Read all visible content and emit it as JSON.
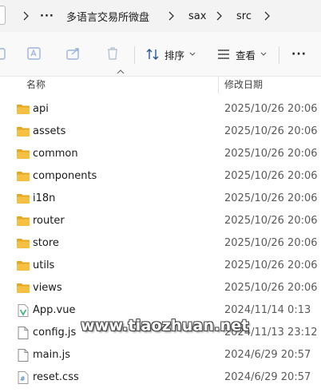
{
  "breadcrumb": {
    "more_label": "···",
    "items": [
      "多语言交易所微盘",
      "sax",
      "src"
    ]
  },
  "toolbar": {
    "sort_label": "排序",
    "view_label": "查看",
    "more_label": "···"
  },
  "columns": {
    "name": "名称",
    "date_modified": "修改日期"
  },
  "files": [
    {
      "name": "api",
      "date": "2025/10/26 20:06",
      "type": "folder"
    },
    {
      "name": "assets",
      "date": "2025/10/26 20:06",
      "type": "folder"
    },
    {
      "name": "common",
      "date": "2025/10/26 20:06",
      "type": "folder"
    },
    {
      "name": "components",
      "date": "2025/10/26 20:06",
      "type": "folder"
    },
    {
      "name": "i18n",
      "date": "2025/10/26 20:06",
      "type": "folder"
    },
    {
      "name": "router",
      "date": "2025/10/26 20:06",
      "type": "folder"
    },
    {
      "name": "store",
      "date": "2025/10/26 20:06",
      "type": "folder"
    },
    {
      "name": "utils",
      "date": "2025/10/26 20:06",
      "type": "folder"
    },
    {
      "name": "views",
      "date": "2025/10/26 20:06",
      "type": "folder"
    },
    {
      "name": "App.vue",
      "date": "2024/11/14 0:13",
      "type": "vue"
    },
    {
      "name": "config.js",
      "date": "2024/11/13 23:12",
      "type": "file"
    },
    {
      "name": "main.js",
      "date": "2024/6/29 20:57",
      "type": "file"
    },
    {
      "name": "reset.css",
      "date": "2024/6/29 20:57",
      "type": "css"
    }
  ],
  "watermark": "www.tiaozhuan.net",
  "colors": {
    "folder": "#f6c143",
    "folder_dark": "#e5a823",
    "vue_green": "#41b883",
    "css_blue": "#2a6fd6"
  }
}
